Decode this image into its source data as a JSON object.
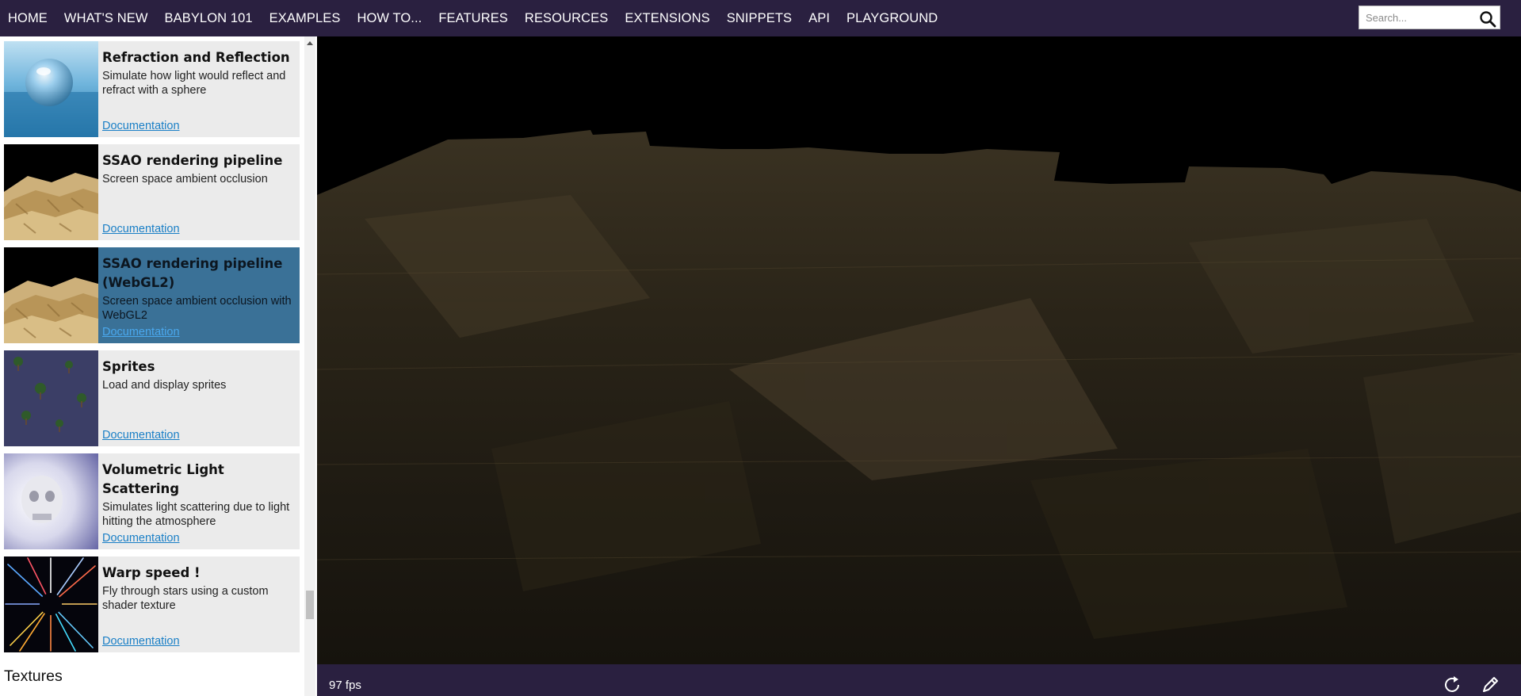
{
  "nav": {
    "items": [
      "HOME",
      "WHAT'S NEW",
      "BABYLON 101",
      "EXAMPLES",
      "HOW TO...",
      "FEATURES",
      "RESOURCES",
      "EXTENSIONS",
      "SNIPPETS",
      "API",
      "PLAYGROUND"
    ]
  },
  "search": {
    "placeholder": "Search..."
  },
  "cards": [
    {
      "title": "Refraction and Reflection",
      "description": "Simulate how light would reflect and refract with a sphere",
      "link": "Documentation",
      "thumbnail": "glass-sphere"
    },
    {
      "title": "SSAO rendering pipeline",
      "description": "Screen space ambient occlusion",
      "link": "Documentation",
      "thumbnail": "sand-blocks"
    },
    {
      "title": "SSAO rendering pipeline (WebGL2)",
      "description": "Screen space ambient occlusion with WebGL2",
      "link": "Documentation",
      "thumbnail": "sand-blocks",
      "active": true
    },
    {
      "title": "Sprites",
      "description": "Load and display sprites",
      "link": "Documentation",
      "thumbnail": "palm-trees"
    },
    {
      "title": "Volumetric Light Scattering",
      "description": "Simulates light scattering due to light hitting the atmosphere",
      "link": "Documentation",
      "thumbnail": "skull-light"
    },
    {
      "title": "Warp speed !",
      "description": "Fly through stars using a custom shader texture",
      "link": "Documentation",
      "thumbnail": "star-warp"
    }
  ],
  "section_heading": "Textures",
  "footer": {
    "fps": "97 fps",
    "icons": [
      "refresh-icon",
      "edit-pencil-icon"
    ]
  },
  "colors": {
    "topbar": "#2a2040",
    "active_card": "#3a7197",
    "link": "#1a7fc6"
  }
}
